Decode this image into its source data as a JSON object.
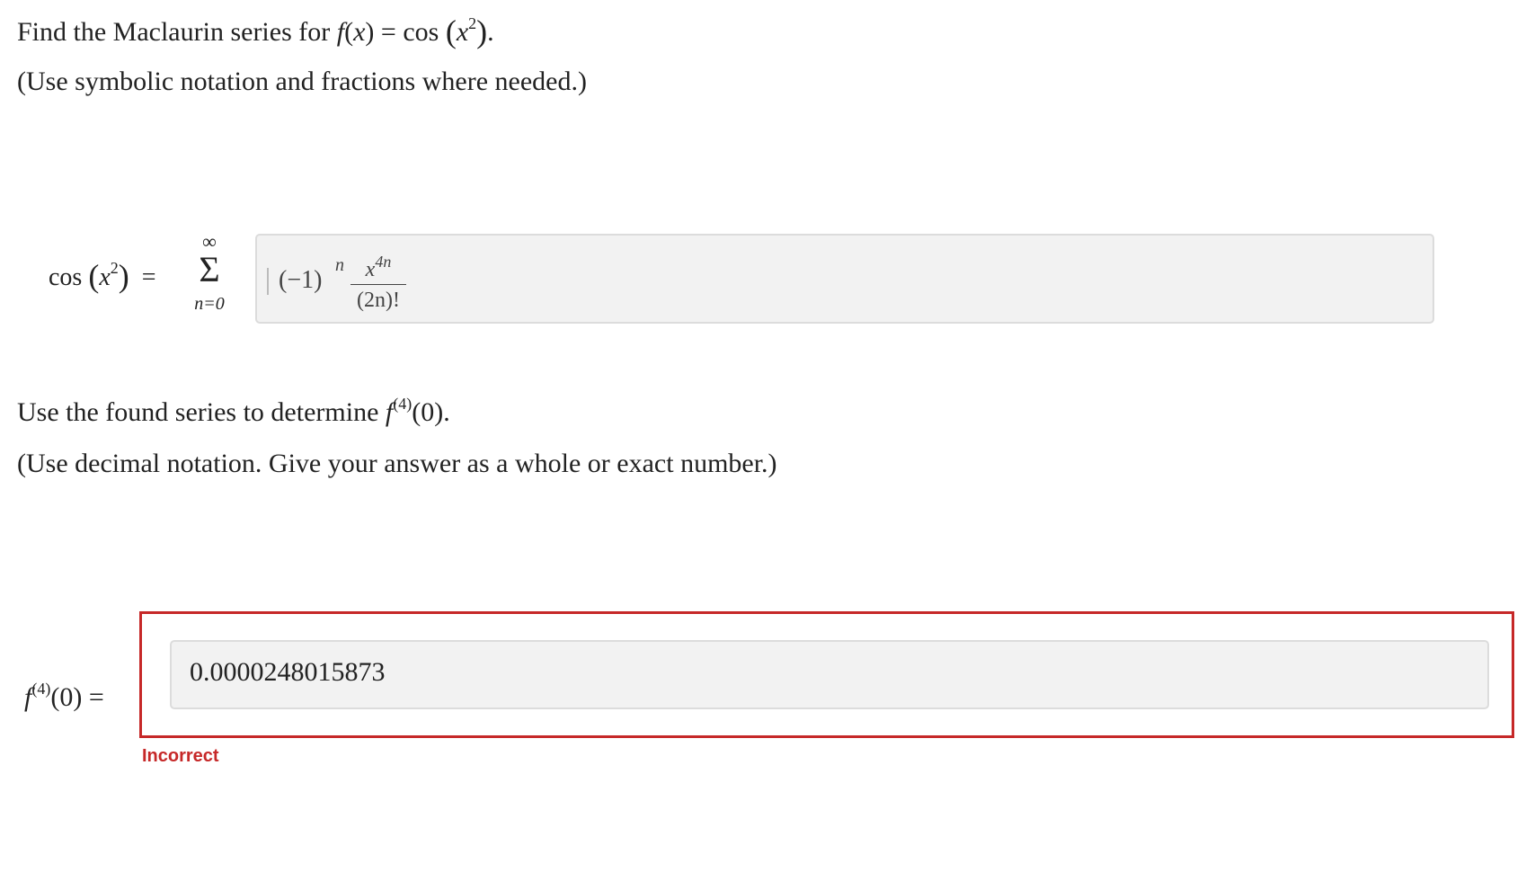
{
  "question1": {
    "text_prefix": "Find the Maclaurin series for",
    "function_name": "f",
    "arg": "x",
    "equals": "=",
    "cos": "cos",
    "base": "x",
    "power": "2",
    "period": "."
  },
  "hint1": "(Use symbolic notation and fractions where needed.)",
  "series": {
    "lhs_cos": "cos",
    "lhs_base": "x",
    "lhs_power": "2",
    "equals": "=",
    "sum_upper": "∞",
    "sum_symbol": "Σ",
    "sum_lower": "n=0",
    "answer_neg_one": "(−1)",
    "answer_exp": "n",
    "answer_num_base": "x",
    "answer_num_exp": "4n",
    "answer_den": "(2n)!"
  },
  "question2": {
    "text_prefix": "Use the found series to determine",
    "function_name": "f",
    "derivative_order": "(4)",
    "arg": "(0)",
    "period": "."
  },
  "hint2": "(Use decimal notation. Give your answer as a whole or exact number.)",
  "answer": {
    "label_func": "f",
    "label_order": "(4)",
    "label_arg": "(0)",
    "label_equals": "=",
    "value": "0.0000248015873",
    "status": "Incorrect"
  },
  "colors": {
    "error": "#c62828",
    "input_bg": "#f2f2f2"
  }
}
